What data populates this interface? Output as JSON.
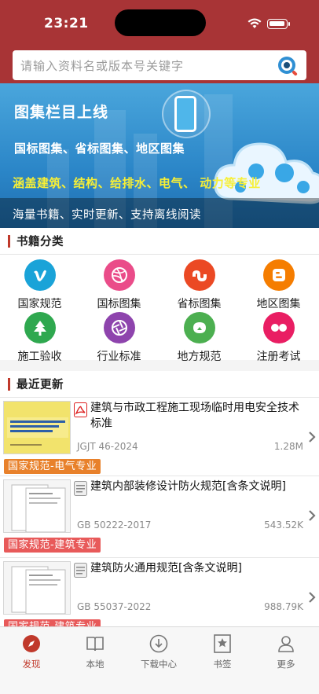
{
  "status_bar": {
    "time": "23:21"
  },
  "search": {
    "placeholder": "请输入资料名或版本号关键字"
  },
  "banner": {
    "title": "图集栏目上线",
    "line1": "国标图集、省标图集、地区图集",
    "line2": "涵盖建筑、结构、给排水、电气、 动力等专业",
    "footer": "海量书籍、实时更新、支持离线阅读"
  },
  "categories_section": {
    "title": "书籍分类",
    "items": [
      {
        "label": "国家规范",
        "icon": "vimeo-icon",
        "color": "#1aa3d8"
      },
      {
        "label": "国标图集",
        "icon": "dribbble-icon",
        "color": "#ea4c89"
      },
      {
        "label": "省标图集",
        "icon": "stumbleupon-icon",
        "color": "#eb4924"
      },
      {
        "label": "地区图集",
        "icon": "blogger-icon",
        "color": "#f57d00"
      },
      {
        "label": "施工验收",
        "icon": "tree-icon",
        "color": "#2fa84f"
      },
      {
        "label": "行业标准",
        "icon": "aperture-icon",
        "color": "#8e44ad"
      },
      {
        "label": "地方规范",
        "icon": "houzz-icon",
        "color": "#4caf50"
      },
      {
        "label": "注册考试",
        "icon": "flickr-icon",
        "color": "#e91e63"
      }
    ]
  },
  "recent_section": {
    "title": "最近更新",
    "items": [
      {
        "title": "建筑与市政工程施工现场临时用电安全技术标准",
        "code": "JGJT 46-2024",
        "size": "1.28M",
        "tag": "国家规范-电气专业",
        "tag_color": "#e8812b",
        "doc_type": "pdf-icon"
      },
      {
        "title": "建筑内部装修设计防火规范[含条文说明]",
        "code": "GB 50222-2017",
        "size": "543.52K",
        "tag": "国家规范-建筑专业",
        "tag_color": "#e85a5a",
        "doc_type": "document-icon"
      },
      {
        "title": "建筑防火通用规范[含条文说明]",
        "code": "GB 55037-2022",
        "size": "988.79K",
        "tag": "国家规范-建筑专业",
        "tag_color": "#e85a5a",
        "doc_type": "document-icon"
      }
    ]
  },
  "tabbar": {
    "items": [
      {
        "label": "发现",
        "icon": "compass-icon",
        "active": true
      },
      {
        "label": "本地",
        "icon": "book-icon",
        "active": false
      },
      {
        "label": "下载中心",
        "icon": "download-icon",
        "active": false
      },
      {
        "label": "书签",
        "icon": "bookmark-icon",
        "active": false
      },
      {
        "label": "更多",
        "icon": "user-icon",
        "active": false
      }
    ]
  }
}
